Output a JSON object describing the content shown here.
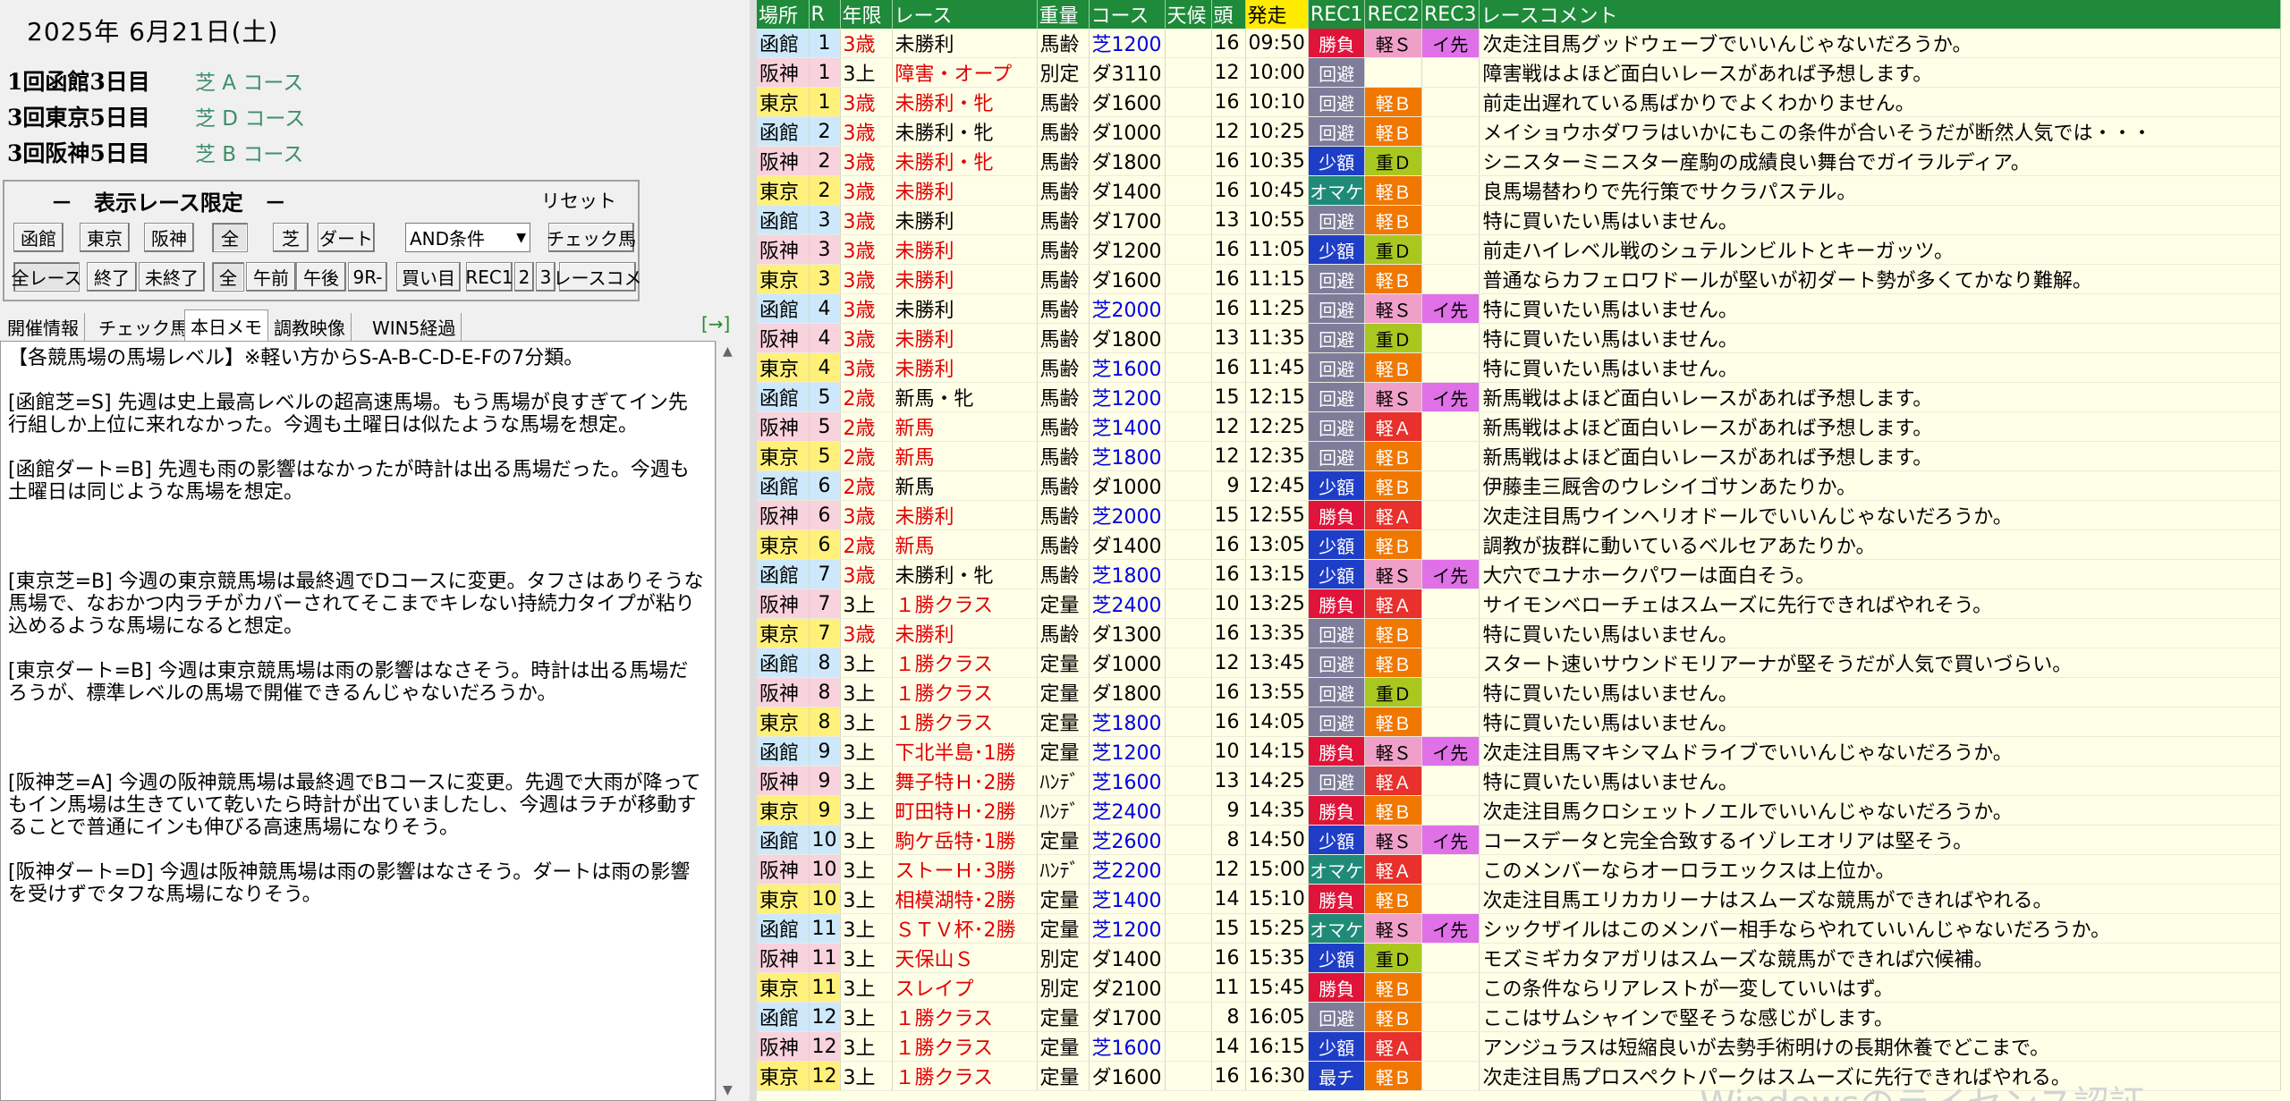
{
  "header": {
    "date": "2025年 6月21日(土)",
    "meetings": [
      {
        "name": "1回函館3日目",
        "course": "芝 A コース"
      },
      {
        "name": "3回東京5日目",
        "course": "芝 D コース"
      },
      {
        "name": "3回阪神5日目",
        "course": "芝 B コース"
      }
    ]
  },
  "filter": {
    "title": "－　表示レース限定　－",
    "reset": "リセット",
    "venues": [
      "函館",
      "東京",
      "阪神"
    ],
    "surface": [
      "全",
      "芝",
      "ダート"
    ],
    "condition": "AND条件",
    "check_button": "チェック馬",
    "status": [
      "全レース",
      "終了",
      "未終了"
    ],
    "time": [
      "全",
      "午前",
      "午後",
      "9R-"
    ],
    "extra": [
      "買い目",
      "REC1",
      "2",
      "3",
      "レースコメ"
    ]
  },
  "tabs": [
    "開催情報",
    "チェック馬",
    "本日メモ",
    "調教映像",
    "WIN5経過"
  ],
  "tab_arrow": "[→]",
  "memo": "【各競馬場の馬場レベル】※軽い方からS-A-B-C-D-E-Fの7分類。\n\n[函館芝=S] 先週は史上最高レベルの超高速馬場。もう馬場が良すぎてイン先行組しか上位に来れなかった。今週も土曜日は似たような馬場を想定。\n\n[函館ダート=B] 先週も雨の影響はなかったが時計は出る馬場だった。今週も土曜日は同じような馬場を想定。\n\n\n\n[東京芝=B] 今週の東京競馬場は最終週でDコースに変更。タフさはありそうな馬場で、なおかつ内ラチがカバーされてそこまでキレない持続力タイプが粘り込めるような馬場になると想定。\n\n[東京ダート=B] 今週は東京競馬場は雨の影響はなさそう。時計は出る馬場だろうが、標準レベルの馬場で開催できるんじゃないだろうか。\n\n\n\n[阪神芝=A] 今週の阪神競馬場は最終週でBコースに変更。先週で大雨が降ってもイン馬場は生きていて乾いたら時計が出ていましたし、今週はラチが移動することで普通にインも伸びる高速馬場になりそう。\n\n[阪神ダート=D] 今週は阪神競馬場は雨の影響はなさそう。ダートは雨の影響を受けずでタフな馬場になりそう。",
  "columns": [
    "場所",
    "R",
    "年限",
    "レース",
    "重量",
    "コース",
    "天候",
    "頭",
    "発走",
    "REC1",
    "REC2",
    "REC3",
    "レースコメント"
  ],
  "rows": [
    {
      "venue": "函館",
      "r": "1",
      "age": "3歳",
      "race": "未勝利",
      "weight": "馬齢",
      "course": "芝1200",
      "tenko": "",
      "heads": "16",
      "time": "09:50",
      "rec1": "勝負",
      "rec2": "軽Ｓ",
      "rec3": "イ先",
      "comment": "次走注目馬グッドウェーブでいいんじゃないだろうか。"
    },
    {
      "venue": "阪神",
      "r": "1",
      "age": "3上",
      "race": "障害・オープ",
      "weight": "別定",
      "course": "ダ3110",
      "tenko": "",
      "heads": "12",
      "time": "10:00",
      "rec1": "回避",
      "rec2": "",
      "rec3": "",
      "comment": "障害戦はよほど面白いレースがあれば予想します。"
    },
    {
      "venue": "東京",
      "r": "1",
      "age": "3歳",
      "race": "未勝利・牝",
      "weight": "馬齢",
      "course": "ダ1600",
      "tenko": "",
      "heads": "16",
      "time": "10:10",
      "rec1": "回避",
      "rec2": "軽Ｂ",
      "rec3": "",
      "comment": "前走出遅れている馬ばかりでよくわかりません。"
    },
    {
      "venue": "函館",
      "r": "2",
      "age": "3歳",
      "race": "未勝利・牝",
      "weight": "馬齢",
      "course": "ダ1000",
      "tenko": "",
      "heads": "12",
      "time": "10:25",
      "rec1": "回避",
      "rec2": "軽Ｂ",
      "rec3": "",
      "comment": "メイショウホダワラはいかにもこの条件が合いそうだが断然人気では・・・"
    },
    {
      "venue": "阪神",
      "r": "2",
      "age": "3歳",
      "race": "未勝利・牝",
      "weight": "馬齢",
      "course": "ダ1800",
      "tenko": "",
      "heads": "16",
      "time": "10:35",
      "rec1": "少額",
      "rec2": "重Ｄ",
      "rec3": "",
      "comment": "シニスターミニスター産駒の成績良い舞台でガイラルディア。"
    },
    {
      "venue": "東京",
      "r": "2",
      "age": "3歳",
      "race": "未勝利",
      "weight": "馬齢",
      "course": "ダ1400",
      "tenko": "",
      "heads": "16",
      "time": "10:45",
      "rec1": "オマケ",
      "rec2": "軽Ｂ",
      "rec3": "",
      "comment": "良馬場替わりで先行策でサクラパステル。"
    },
    {
      "venue": "函館",
      "r": "3",
      "age": "3歳",
      "race": "未勝利",
      "weight": "馬齢",
      "course": "ダ1700",
      "tenko": "",
      "heads": "13",
      "time": "10:55",
      "rec1": "回避",
      "rec2": "軽Ｂ",
      "rec3": "",
      "comment": "特に買いたい馬はいません。"
    },
    {
      "venue": "阪神",
      "r": "3",
      "age": "3歳",
      "race": "未勝利",
      "weight": "馬齢",
      "course": "ダ1200",
      "tenko": "",
      "heads": "16",
      "time": "11:05",
      "rec1": "少額",
      "rec2": "重Ｄ",
      "rec3": "",
      "comment": "前走ハイレベル戦のシュテルンビルトとキーガッツ。"
    },
    {
      "venue": "東京",
      "r": "3",
      "age": "3歳",
      "race": "未勝利",
      "weight": "馬齢",
      "course": "ダ1600",
      "tenko": "",
      "heads": "16",
      "time": "11:15",
      "rec1": "回避",
      "rec2": "軽Ｂ",
      "rec3": "",
      "comment": "普通ならカフェロワドールが堅いが初ダート勢が多くてかなり難解。"
    },
    {
      "venue": "函館",
      "r": "4",
      "age": "3歳",
      "race": "未勝利",
      "weight": "馬齢",
      "course": "芝2000",
      "tenko": "",
      "heads": "16",
      "time": "11:25",
      "rec1": "回避",
      "rec2": "軽Ｓ",
      "rec3": "イ先",
      "comment": "特に買いたい馬はいません。"
    },
    {
      "venue": "阪神",
      "r": "4",
      "age": "3歳",
      "race": "未勝利",
      "weight": "馬齢",
      "course": "ダ1800",
      "tenko": "",
      "heads": "13",
      "time": "11:35",
      "rec1": "回避",
      "rec2": "重Ｄ",
      "rec3": "",
      "comment": "特に買いたい馬はいません。"
    },
    {
      "venue": "東京",
      "r": "4",
      "age": "3歳",
      "race": "未勝利",
      "weight": "馬齢",
      "course": "芝1600",
      "tenko": "",
      "heads": "16",
      "time": "11:45",
      "rec1": "回避",
      "rec2": "軽Ｂ",
      "rec3": "",
      "comment": "特に買いたい馬はいません。"
    },
    {
      "venue": "函館",
      "r": "5",
      "age": "2歳",
      "race": "新馬・牝",
      "weight": "馬齢",
      "course": "芝1200",
      "tenko": "",
      "heads": "15",
      "time": "12:15",
      "rec1": "回避",
      "rec2": "軽Ｓ",
      "rec3": "イ先",
      "comment": "新馬戦はよほど面白いレースがあれば予想します。"
    },
    {
      "venue": "阪神",
      "r": "5",
      "age": "2歳",
      "race": "新馬",
      "weight": "馬齢",
      "course": "芝1400",
      "tenko": "",
      "heads": "12",
      "time": "12:25",
      "rec1": "回避",
      "rec2": "軽Ａ",
      "rec3": "",
      "comment": "新馬戦はよほど面白いレースがあれば予想します。"
    },
    {
      "venue": "東京",
      "r": "5",
      "age": "2歳",
      "race": "新馬",
      "weight": "馬齢",
      "course": "芝1800",
      "tenko": "",
      "heads": "12",
      "time": "12:35",
      "rec1": "回避",
      "rec2": "軽Ｂ",
      "rec3": "",
      "comment": "新馬戦はよほど面白いレースがあれば予想します。"
    },
    {
      "venue": "函館",
      "r": "6",
      "age": "2歳",
      "race": "新馬",
      "weight": "馬齢",
      "course": "ダ1000",
      "tenko": "",
      "heads": "9",
      "time": "12:45",
      "rec1": "少額",
      "rec2": "軽Ｂ",
      "rec3": "",
      "comment": "伊藤圭三厩舎のウレシイゴサンあたりか。"
    },
    {
      "venue": "阪神",
      "r": "6",
      "age": "3歳",
      "race": "未勝利",
      "weight": "馬齢",
      "course": "芝2000",
      "tenko": "",
      "heads": "15",
      "time": "12:55",
      "rec1": "勝負",
      "rec2": "軽Ａ",
      "rec3": "",
      "comment": "次走注目馬ウインヘリオドールでいいんじゃないだろうか。"
    },
    {
      "venue": "東京",
      "r": "6",
      "age": "2歳",
      "race": "新馬",
      "weight": "馬齢",
      "course": "ダ1400",
      "tenko": "",
      "heads": "16",
      "time": "13:05",
      "rec1": "少額",
      "rec2": "軽Ｂ",
      "rec3": "",
      "comment": "調教が抜群に動いているベルセアあたりか。"
    },
    {
      "venue": "函館",
      "r": "7",
      "age": "3歳",
      "race": "未勝利・牝",
      "weight": "馬齢",
      "course": "芝1800",
      "tenko": "",
      "heads": "16",
      "time": "13:15",
      "rec1": "少額",
      "rec2": "軽Ｓ",
      "rec3": "イ先",
      "comment": "大穴でユナホークパワーは面白そう。"
    },
    {
      "venue": "阪神",
      "r": "7",
      "age": "3上",
      "race": "１勝クラス",
      "weight": "定量",
      "course": "芝2400",
      "tenko": "",
      "heads": "10",
      "time": "13:25",
      "rec1": "勝負",
      "rec2": "軽Ａ",
      "rec3": "",
      "comment": "サイモンベローチェはスムーズに先行できればやれそう。"
    },
    {
      "venue": "東京",
      "r": "7",
      "age": "3歳",
      "race": "未勝利",
      "weight": "馬齢",
      "course": "ダ1300",
      "tenko": "",
      "heads": "16",
      "time": "13:35",
      "rec1": "回避",
      "rec2": "軽Ｂ",
      "rec3": "",
      "comment": "特に買いたい馬はいません。"
    },
    {
      "venue": "函館",
      "r": "8",
      "age": "3上",
      "race": "１勝クラス",
      "weight": "定量",
      "course": "ダ1000",
      "tenko": "",
      "heads": "12",
      "time": "13:45",
      "rec1": "回避",
      "rec2": "軽Ｂ",
      "rec3": "",
      "comment": "スタート速いサウンドモリアーナが堅そうだが人気で買いづらい。"
    },
    {
      "venue": "阪神",
      "r": "8",
      "age": "3上",
      "race": "１勝クラス",
      "weight": "定量",
      "course": "ダ1800",
      "tenko": "",
      "heads": "16",
      "time": "13:55",
      "rec1": "回避",
      "rec2": "重Ｄ",
      "rec3": "",
      "comment": "特に買いたい馬はいません。"
    },
    {
      "venue": "東京",
      "r": "8",
      "age": "3上",
      "race": "１勝クラス",
      "weight": "定量",
      "course": "芝1800",
      "tenko": "",
      "heads": "16",
      "time": "14:05",
      "rec1": "回避",
      "rec2": "軽Ｂ",
      "rec3": "",
      "comment": "特に買いたい馬はいません。"
    },
    {
      "venue": "函館",
      "r": "9",
      "age": "3上",
      "race": "下北半島･1勝",
      "weight": "定量",
      "course": "芝1200",
      "tenko": "",
      "heads": "10",
      "time": "14:15",
      "rec1": "勝負",
      "rec2": "軽Ｓ",
      "rec3": "イ先",
      "comment": "次走注目馬マキシマムドライブでいいんじゃないだろうか。"
    },
    {
      "venue": "阪神",
      "r": "9",
      "age": "3上",
      "race": "舞子特Ｈ･2勝",
      "weight": "ﾊﾝﾃﾞ",
      "course": "芝1600",
      "tenko": "",
      "heads": "13",
      "time": "14:25",
      "rec1": "回避",
      "rec2": "軽Ａ",
      "rec3": "",
      "comment": "特に買いたい馬はいません。"
    },
    {
      "venue": "東京",
      "r": "9",
      "age": "3上",
      "race": "町田特Ｈ･2勝",
      "weight": "ﾊﾝﾃﾞ",
      "course": "芝2400",
      "tenko": "",
      "heads": "9",
      "time": "14:35",
      "rec1": "勝負",
      "rec2": "軽Ｂ",
      "rec3": "",
      "comment": "次走注目馬クロシェットノエルでいいんじゃないだろうか。"
    },
    {
      "venue": "函館",
      "r": "10",
      "age": "3上",
      "race": "駒ケ岳特･1勝",
      "weight": "定量",
      "course": "芝2600",
      "tenko": "",
      "heads": "8",
      "time": "14:50",
      "rec1": "少額",
      "rec2": "軽Ｓ",
      "rec3": "イ先",
      "comment": "コースデータと完全合致するイゾレエオリアは堅そう。"
    },
    {
      "venue": "阪神",
      "r": "10",
      "age": "3上",
      "race": "ストーＨ･3勝",
      "weight": "ﾊﾝﾃﾞ",
      "course": "芝2200",
      "tenko": "",
      "heads": "12",
      "time": "15:00",
      "rec1": "オマケ",
      "rec2": "軽Ａ",
      "rec3": "",
      "comment": "このメンバーならオーロラエックスは上位か。"
    },
    {
      "venue": "東京",
      "r": "10",
      "age": "3上",
      "race": "相模湖特･2勝",
      "weight": "定量",
      "course": "芝1400",
      "tenko": "",
      "heads": "14",
      "time": "15:10",
      "rec1": "勝負",
      "rec2": "軽Ｂ",
      "rec3": "",
      "comment": "次走注目馬エリカカリーナはスムーズな競馬ができればやれる。"
    },
    {
      "venue": "函館",
      "r": "11",
      "age": "3上",
      "race": "ＳＴＶ杯･2勝",
      "weight": "定量",
      "course": "芝1200",
      "tenko": "",
      "heads": "15",
      "time": "15:25",
      "rec1": "オマケ",
      "rec2": "軽Ｓ",
      "rec3": "イ先",
      "comment": "シックザイルはこのメンバー相手ならやれていいんじゃないだろうか。"
    },
    {
      "venue": "阪神",
      "r": "11",
      "age": "3上",
      "race": "天保山Ｓ",
      "weight": "別定",
      "course": "ダ1400",
      "tenko": "",
      "heads": "16",
      "time": "15:35",
      "rec1": "少額",
      "rec2": "重Ｄ",
      "rec3": "",
      "comment": "モズミギカタアガリはスムーズな競馬ができれば穴候補。"
    },
    {
      "venue": "東京",
      "r": "11",
      "age": "3上",
      "race": "スレイプ",
      "weight": "別定",
      "course": "ダ2100",
      "tenko": "",
      "heads": "11",
      "time": "15:45",
      "rec1": "勝負",
      "rec2": "軽Ｂ",
      "rec3": "",
      "comment": "この条件ならリアレストが一変していいはず。"
    },
    {
      "venue": "函館",
      "r": "12",
      "age": "3上",
      "race": "１勝クラス",
      "weight": "定量",
      "course": "ダ1700",
      "tenko": "",
      "heads": "8",
      "time": "16:05",
      "rec1": "回避",
      "rec2": "軽Ｂ",
      "rec3": "",
      "comment": "ここはサムシャインで堅そうな感じがします。"
    },
    {
      "venue": "阪神",
      "r": "12",
      "age": "3上",
      "race": "１勝クラス",
      "weight": "定量",
      "course": "芝1600",
      "tenko": "",
      "heads": "14",
      "time": "16:15",
      "rec1": "少額",
      "rec2": "軽Ａ",
      "rec3": "",
      "comment": "アンジュラスは短縮良いが去勢手術明けの長期休養でどこまで。"
    },
    {
      "venue": "東京",
      "r": "12",
      "age": "3上",
      "race": "１勝クラス",
      "weight": "定量",
      "course": "ダ1600",
      "tenko": "",
      "heads": "16",
      "time": "16:30",
      "rec1": "最チ",
      "rec2": "軽Ｂ",
      "rec3": "",
      "comment": "次走注目馬プロスペクトパークはスムーズに先行できればやれる。"
    }
  ],
  "watermark": "Windowsのライセンス認証",
  "colors": {
    "header_green": "#1e8a3a",
    "hakodate": "#cde8fa",
    "hanshin": "#f8d2dc",
    "tokyo": "#fff07a",
    "grid_bg": "#ffffe8"
  }
}
